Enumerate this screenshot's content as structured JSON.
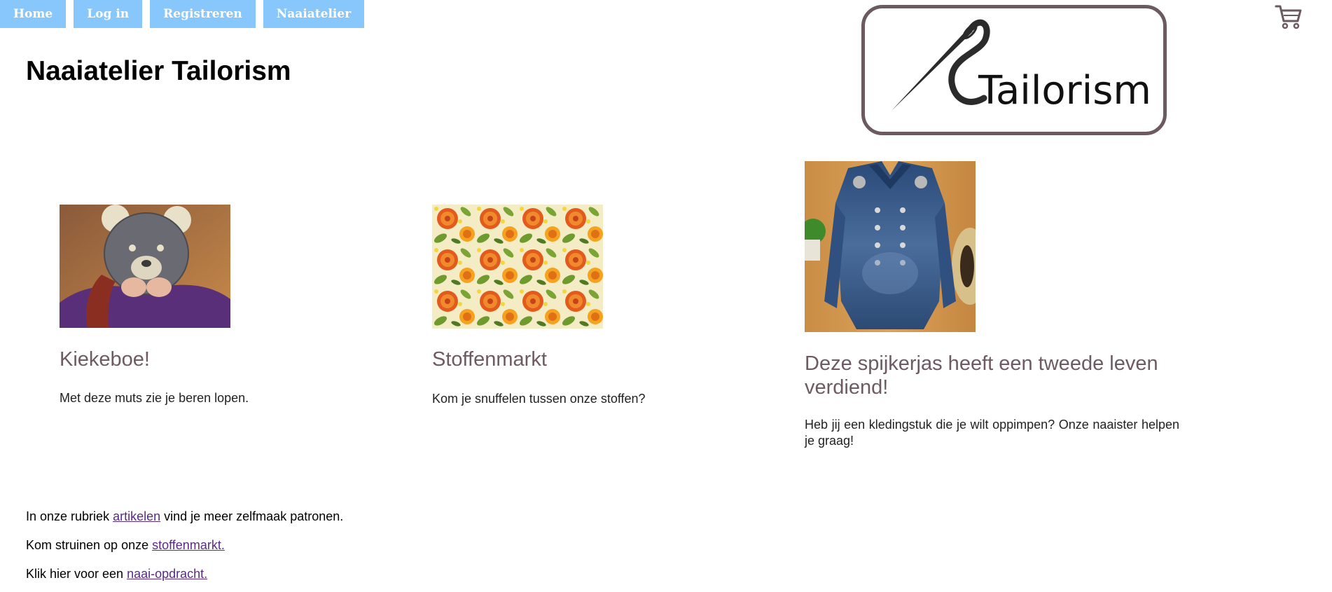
{
  "nav": {
    "items": [
      {
        "label": "Home"
      },
      {
        "label": "Log in"
      },
      {
        "label": "Registreren"
      },
      {
        "label": "Naaiatelier"
      }
    ]
  },
  "header": {
    "title": "Naaiatelier Tailorism",
    "logo_text": "Tailorism"
  },
  "icons": {
    "cart": "shopping-cart-icon",
    "logo": "needle-thread-logo"
  },
  "cards": [
    {
      "title": "Kiekeboe!",
      "text": "Met deze muts zie je beren lopen.",
      "image": "person-in-bear-hat-photo"
    },
    {
      "title": "Stoffenmarkt",
      "text": "Kom je snuffelen tussen onze stoffen?",
      "image": "floral-fabric-photo"
    },
    {
      "title": "Deze spijkerjas heeft een tweede leven verdiend!",
      "text": "Heb jij een kledingstuk die je wilt oppimpen? Onze naaister helpen je graag!",
      "image": "denim-jacket-photo"
    }
  ],
  "footer": {
    "line1": {
      "before": "In onze rubriek ",
      "link": "artikelen",
      "after": " vind je meer zelfmaak patronen."
    },
    "line2": {
      "before": "Kom struinen op onze ",
      "link": "stoffenmarkt.",
      "after": ""
    },
    "line3": {
      "before": "Klik hier voor een ",
      "link": "naai-opdracht.",
      "after": ""
    }
  },
  "colors": {
    "nav_bg": "#87c7fb",
    "card_title": "#6e5a63",
    "link": "#5b2a86",
    "logo_border": "#6b5a60"
  }
}
